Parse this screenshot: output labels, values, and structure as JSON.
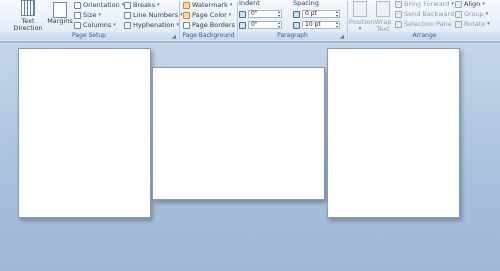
{
  "ribbon": {
    "page_setup": {
      "text_direction_label": "Text Direction",
      "margins_label": "Margins",
      "orientation_label": "Orientation",
      "size_label": "Size",
      "columns_label": "Columns",
      "breaks_label": "Breaks",
      "line_numbers_label": "Line Numbers",
      "hyphenation_label": "Hyphenation",
      "group_label": "Page Setup"
    },
    "page_background": {
      "watermark_label": "Watermark",
      "page_color_label": "Page Color",
      "page_borders_label": "Page Borders",
      "group_label": "Page Background"
    },
    "paragraph": {
      "indent_label": "Indent",
      "indent_left_value": "0\"",
      "indent_right_value": "0\"",
      "spacing_label": "Spacing",
      "spacing_before_value": "0 pt",
      "spacing_after_value": "10 pt",
      "group_label": "Paragraph"
    },
    "arrange": {
      "position_label": "Position",
      "wrap_text_label": "Wrap Text",
      "bring_forward_label": "Bring Forward",
      "send_backward_label": "Send Backward",
      "selection_pane_label": "Selection Pane",
      "align_label": "Align",
      "group_btn_label": "Group",
      "rotate_label": "Rotate",
      "group_label": "Arrange"
    }
  },
  "colors": {
    "workspace": "#a9c1dd",
    "ribbon_bg": "#e8eff8",
    "page": "#ffffff"
  }
}
